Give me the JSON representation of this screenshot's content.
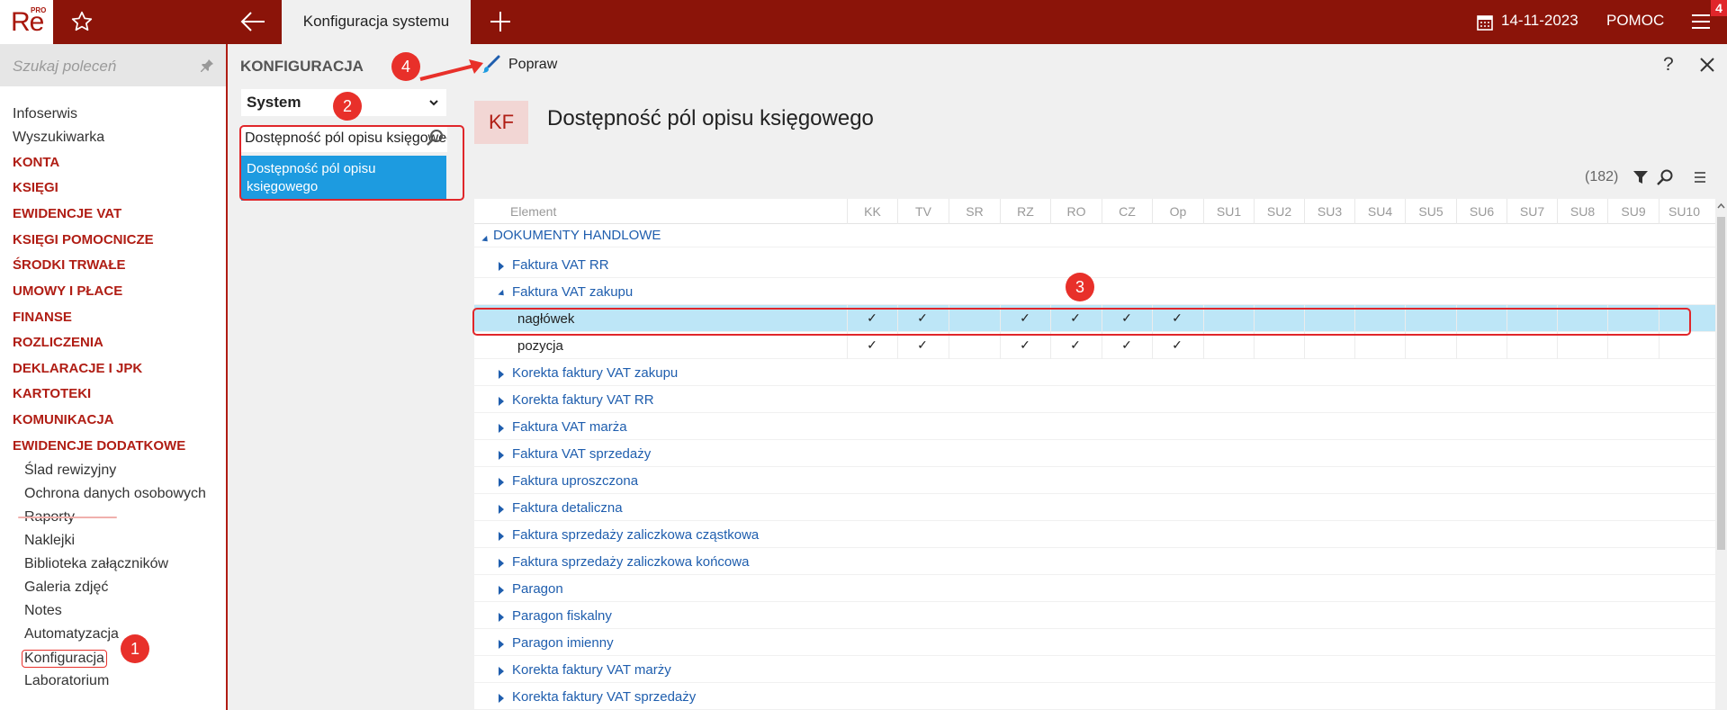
{
  "topbar": {
    "logo_text": "Re",
    "logo_sup": "PRO",
    "tab_title": "Konfiguracja systemu",
    "date": "14-11-2023",
    "help_label": "POMOC",
    "notification_count": "4"
  },
  "sidebar": {
    "search_placeholder": "Szukaj poleceń",
    "items": [
      {
        "label": "Infoserwis",
        "kind": "plain"
      },
      {
        "label": "Wyszukiwarka",
        "kind": "plain"
      },
      {
        "label": "KONTA",
        "kind": "section"
      },
      {
        "label": "KSIĘGI",
        "kind": "section"
      },
      {
        "label": "EWIDENCJE VAT",
        "kind": "section"
      },
      {
        "label": "KSIĘGI POMOCNICZE",
        "kind": "section"
      },
      {
        "label": "ŚRODKI TRWAŁE",
        "kind": "section"
      },
      {
        "label": "UMOWY I PŁACE",
        "kind": "section"
      },
      {
        "label": "FINANSE",
        "kind": "section"
      },
      {
        "label": "ROZLICZENIA",
        "kind": "section"
      },
      {
        "label": "DEKLARACJE I JPK",
        "kind": "section"
      },
      {
        "label": "KARTOTEKI",
        "kind": "section"
      },
      {
        "label": "KOMUNIKACJA",
        "kind": "section"
      },
      {
        "label": "EWIDENCJE DODATKOWE",
        "kind": "section"
      },
      {
        "label": "Ślad rewizyjny",
        "kind": "sub"
      },
      {
        "label": "Ochrona danych osobowych",
        "kind": "sub"
      },
      {
        "label": "Raporty",
        "kind": "sub"
      },
      {
        "label": "Naklejki",
        "kind": "sub"
      },
      {
        "label": "Biblioteka załączników",
        "kind": "sub"
      },
      {
        "label": "Galeria zdjęć",
        "kind": "sub"
      },
      {
        "label": "Notes",
        "kind": "sub"
      },
      {
        "label": "Automatyzacja",
        "kind": "sub"
      },
      {
        "label": "Konfiguracja",
        "kind": "sub",
        "active": true
      },
      {
        "label": "Laboratorium",
        "kind": "sub"
      }
    ]
  },
  "config_panel": {
    "heading": "KONFIGURACJA",
    "select_value": "System",
    "search_value": "Dostępność pól opisu księgowego",
    "suggestion": "Dostępność pól opisu księgowego"
  },
  "main": {
    "edit_label": "Popraw",
    "help": "?",
    "badge": "KF",
    "title": "Dostępność pól opisu księgowego",
    "count": "(182)",
    "columns": [
      "Element",
      "KK",
      "TV",
      "SR",
      "RZ",
      "RO",
      "CZ",
      "Op",
      "SU1",
      "SU2",
      "SU3",
      "SU4",
      "SU5",
      "SU6",
      "SU7",
      "SU8",
      "SU9",
      "SU10"
    ],
    "rows": [
      {
        "label": "DOKUMENTY HANDLOWE",
        "level": 0,
        "expanded": true,
        "link": true,
        "checks": []
      },
      {
        "label": "Faktura VAT RR",
        "level": 1,
        "expanded": false,
        "link": true,
        "checks": []
      },
      {
        "label": "Faktura VAT zakupu",
        "level": 1,
        "expanded": true,
        "link": true,
        "checks": []
      },
      {
        "label": "nagłówek",
        "level": 2,
        "link": false,
        "selected": true,
        "checks": [
          "KK",
          "TV",
          "RZ",
          "RO",
          "CZ",
          "Op"
        ]
      },
      {
        "label": "pozycja",
        "level": 2,
        "link": false,
        "checks": [
          "KK",
          "TV",
          "RZ",
          "RO",
          "CZ",
          "Op"
        ]
      },
      {
        "label": "Korekta faktury VAT zakupu",
        "level": 1,
        "expanded": false,
        "link": true,
        "checks": []
      },
      {
        "label": "Korekta faktury VAT RR",
        "level": 1,
        "expanded": false,
        "link": true,
        "checks": []
      },
      {
        "label": "Faktura VAT marża",
        "level": 1,
        "expanded": false,
        "link": true,
        "checks": []
      },
      {
        "label": "Faktura VAT sprzedaży",
        "level": 1,
        "expanded": false,
        "link": true,
        "checks": []
      },
      {
        "label": "Faktura uproszczona",
        "level": 1,
        "expanded": false,
        "link": true,
        "checks": []
      },
      {
        "label": "Faktura detaliczna",
        "level": 1,
        "expanded": false,
        "link": true,
        "checks": []
      },
      {
        "label": "Faktura sprzedaży zaliczkowa cząstkowa",
        "level": 1,
        "expanded": false,
        "link": true,
        "checks": []
      },
      {
        "label": "Faktura sprzedaży zaliczkowa końcowa",
        "level": 1,
        "expanded": false,
        "link": true,
        "checks": []
      },
      {
        "label": "Paragon",
        "level": 1,
        "expanded": false,
        "link": true,
        "checks": []
      },
      {
        "label": "Paragon fiskalny",
        "level": 1,
        "expanded": false,
        "link": true,
        "checks": []
      },
      {
        "label": "Paragon imienny",
        "level": 1,
        "expanded": false,
        "link": true,
        "checks": []
      },
      {
        "label": "Korekta faktury VAT marży",
        "level": 1,
        "expanded": false,
        "link": true,
        "checks": []
      },
      {
        "label": "Korekta faktury VAT sprzedaży",
        "level": 1,
        "expanded": false,
        "link": true,
        "checks": []
      }
    ]
  },
  "callouts": [
    "1",
    "2",
    "3",
    "4"
  ],
  "colors": {
    "brand": "#8b1409",
    "accent_red": "#e8302a",
    "link": "#1f5eae",
    "selection": "#bde6f7",
    "suggestion": "#1d9be0"
  }
}
